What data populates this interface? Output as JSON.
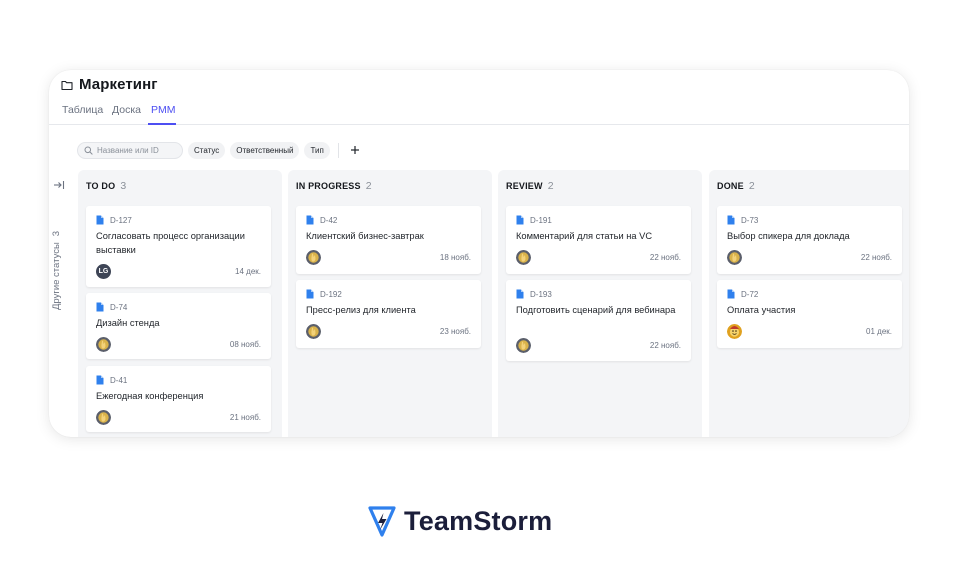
{
  "page": {
    "title": "Маркетинг",
    "tabs": [
      {
        "label": "Таблица",
        "active": false
      },
      {
        "label": "Доска",
        "active": false
      },
      {
        "label": "PMM",
        "active": true
      }
    ]
  },
  "filters": {
    "search_placeholder": "Название или ID",
    "chips": [
      "Статус",
      "Ответственный",
      "Тип"
    ]
  },
  "sidebar": {
    "other_statuses_label": "Другие статусы",
    "other_statuses_count": "3"
  },
  "colors": {
    "accent": "#4d4ff2",
    "card_icon": "#2f80ed",
    "column_bg": "#f4f5f7",
    "brand_text": "#1b1e3a"
  },
  "columns": [
    {
      "name": "TO DO",
      "count": "3",
      "cards": [
        {
          "id": "D-127",
          "title": "Согласовать процесс организации выставки",
          "date": "14 дек.",
          "avatar": "LG",
          "avatar_type": "initials"
        },
        {
          "id": "D-74",
          "title": "Дизайн стенда",
          "date": "08 нояб.",
          "avatar": "",
          "avatar_type": "photo"
        },
        {
          "id": "D-41",
          "title": "Ежегодная конференция",
          "date": "21 нояб.",
          "avatar": "",
          "avatar_type": "photo"
        }
      ]
    },
    {
      "name": "IN PROGRESS",
      "count": "2",
      "cards": [
        {
          "id": "D-42",
          "title": "Клиентский бизнес-завтрак",
          "date": "18 нояб.",
          "avatar": "",
          "avatar_type": "photo"
        },
        {
          "id": "D-192",
          "title": "Пресс-релиз для клиента",
          "date": "23 нояб.",
          "avatar": "",
          "avatar_type": "photo"
        }
      ]
    },
    {
      "name": "REVIEW",
      "count": "2",
      "cards": [
        {
          "id": "D-191",
          "title": "Комментарий для статьи на VC",
          "date": "22 нояб.",
          "avatar": "",
          "avatar_type": "photo"
        },
        {
          "id": "D-193",
          "title": "Подготовить сценарий для вебинара",
          "date": "22 нояб.",
          "avatar": "",
          "avatar_type": "photo"
        }
      ]
    },
    {
      "name": "DONE",
      "count": "2",
      "cards": [
        {
          "id": "D-73",
          "title": "Выбор спикера для доклада",
          "date": "22 нояб.",
          "avatar": "",
          "avatar_type": "photo"
        },
        {
          "id": "D-72",
          "title": "Оплата участия",
          "date": "01 дек.",
          "avatar": "",
          "avatar_type": "photo-alt"
        }
      ]
    }
  ],
  "brand": {
    "name": "TeamStorm"
  }
}
